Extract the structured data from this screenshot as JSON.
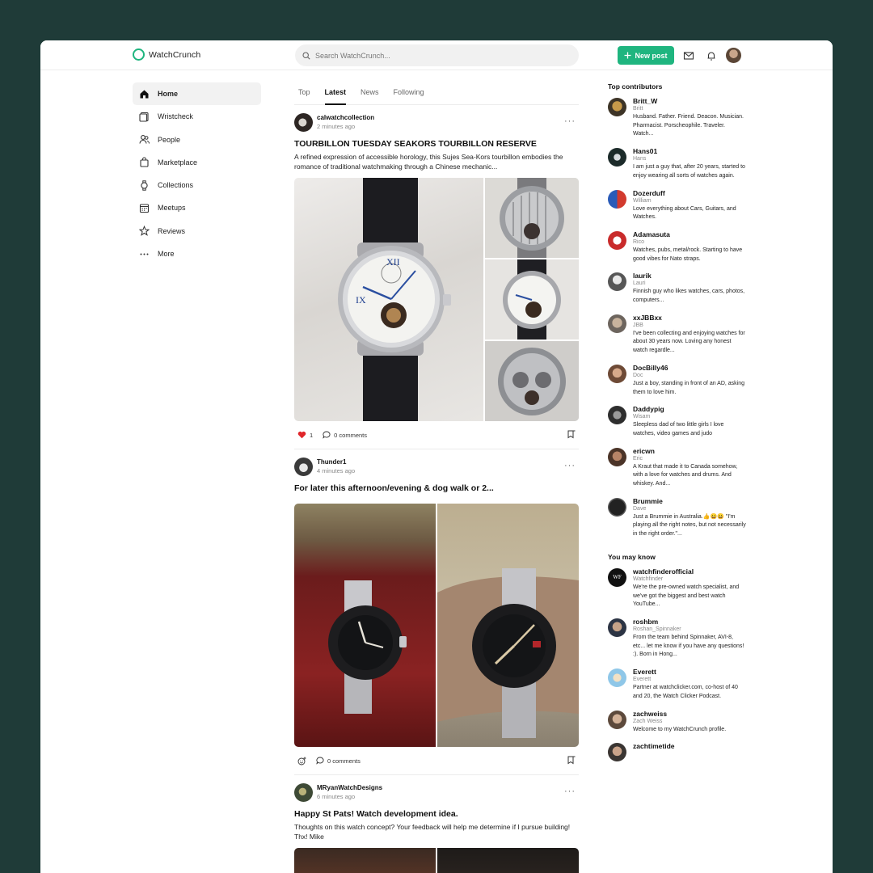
{
  "app": {
    "name": "WatchCrunch"
  },
  "header": {
    "search_placeholder": "Search WatchCrunch...",
    "new_post_label": "New post",
    "accent": "#1fb57f"
  },
  "nav": {
    "items": [
      {
        "label": "Home",
        "icon": "home-icon"
      },
      {
        "label": "Wristcheck",
        "icon": "wristcheck-icon"
      },
      {
        "label": "People",
        "icon": "people-icon"
      },
      {
        "label": "Marketplace",
        "icon": "bag-icon"
      },
      {
        "label": "Collections",
        "icon": "watch-icon"
      },
      {
        "label": "Meetups",
        "icon": "calendar-icon"
      },
      {
        "label": "Reviews",
        "icon": "star-icon"
      },
      {
        "label": "More",
        "icon": "more-icon"
      }
    ]
  },
  "feed": {
    "tabs": [
      "Top",
      "Latest",
      "News",
      "Following"
    ],
    "active_tab": "Latest",
    "posts": [
      {
        "author": "calwatchcollection",
        "time": "2 minutes ago",
        "title": "TOURBILLON TUESDAY SEAKORS TOURBILLON RESERVE",
        "excerpt": "A refined expression of accessible horology, this Sujes Sea-Kors tourbillon embodies the romance of traditional watchmaking through a Chinese mechanic...",
        "likes": "1",
        "comments": "0 comments"
      },
      {
        "author": "Thunder1",
        "time": "4 minutes ago",
        "title": "For later this afternoon/evening & dog walk or 2...",
        "comments": "0 comments"
      },
      {
        "author": "MRyanWatchDesigns",
        "time": "6 minutes ago",
        "title": "Happy St Pats! Watch development idea.",
        "excerpt": "Thoughts on this watch concept? Your feedback will help me determine if I pursue building! Thx! Mike"
      }
    ]
  },
  "rail": {
    "top_title": "Top contributors",
    "top": [
      {
        "name": "Britt_W",
        "handle": "Britt",
        "bio": "Husband. Father. Friend. Deacon. Musician. Pharmacist. Porscheophile. Traveler. Watch..."
      },
      {
        "name": "Hans01",
        "handle": "Hans",
        "bio": "I am just a guy that, after 20 years, started to enjoy wearing all sorts of watches again."
      },
      {
        "name": "Dozerduff",
        "handle": "William",
        "bio": "Love everything about Cars, Guitars, and Watches."
      },
      {
        "name": "Adamasuta",
        "handle": "Rico",
        "bio": "Watches, pubs, metal/rock. Starting to have good vibes for Nato straps."
      },
      {
        "name": "laurik",
        "handle": "Lauri",
        "bio": "Finnish guy who likes watches, cars, photos, computers..."
      },
      {
        "name": "xxJBBxx",
        "handle": "JBB",
        "bio": "I've been collecting and enjoying watches for about 30 years now. Loving any honest watch regardle..."
      },
      {
        "name": "DocBilly46",
        "handle": "Doc",
        "bio": "Just a boy, standing in front of an AD, asking them to love him."
      },
      {
        "name": "Daddypig",
        "handle": "Wisam",
        "bio": "Sleepless dad of two little girls I love watches, video games and judo"
      },
      {
        "name": "ericwn",
        "handle": "Eric",
        "bio": "A Kraut that made it to Canada somehow, with a love for watches and drums. And whiskey. And..."
      },
      {
        "name": "Brummie",
        "handle": "Dave",
        "bio": "Just a Brummie in Australia.👍😀😀 \"I'm playing all the right notes, but not necessarily in the right order.\"..."
      }
    ],
    "know_title": "You may know",
    "know": [
      {
        "name": "watchfinderofficial",
        "handle": "Watchfinder",
        "bio": "We're the pre-owned watch specialist, and we've got the biggest and best watch YouTube..."
      },
      {
        "name": "roshbm",
        "handle": "Roshan_Spinnaker",
        "bio": "From the team behind Spinnaker, AVI-8, etc... let me know if you have any questions! :). Born in Hong..."
      },
      {
        "name": "Everett",
        "handle": "Everett",
        "bio": "Partner at watchclicker.com, co-host of 40 and 20, the Watch Clicker Podcast."
      },
      {
        "name": "zachweiss",
        "handle": "Zach Weiss",
        "bio": "Welcome to my WatchCrunch profile."
      },
      {
        "name": "zachtimetide",
        "handle": "",
        "bio": ""
      }
    ]
  }
}
